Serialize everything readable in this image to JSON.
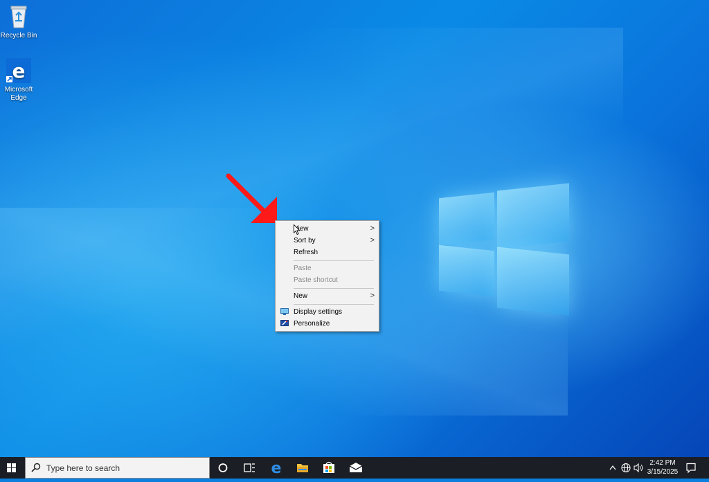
{
  "desktop": {
    "icons": [
      {
        "label": "Recycle Bin",
        "icon": "recycle-bin-icon"
      },
      {
        "label": "Microsoft Edge",
        "icon": "edge-icon"
      }
    ]
  },
  "context_menu": {
    "items": {
      "view": {
        "label": "View"
      },
      "sort_by": {
        "label": "Sort by"
      },
      "refresh": {
        "label": "Refresh"
      },
      "paste": {
        "label": "Paste"
      },
      "paste_shortcut": {
        "label": "Paste shortcut"
      },
      "new": {
        "label": "New"
      },
      "display_settings": {
        "label": "Display settings"
      },
      "personalize": {
        "label": "Personalize"
      }
    },
    "submenu_glyph": ">"
  },
  "taskbar": {
    "search_placeholder": "Type here to search",
    "apps": [
      "cortana-icon",
      "task-view-icon",
      "edge-icon",
      "file-explorer-icon",
      "store-icon",
      "mail-icon"
    ],
    "clock": {
      "time": "2:42 PM",
      "date": "3/15/2025"
    }
  },
  "colors": {
    "accent": "#0a7fe0",
    "taskbar": "#1b1e24",
    "menu_bg": "#f2f2f2",
    "arrow": "#ff1a1a"
  }
}
